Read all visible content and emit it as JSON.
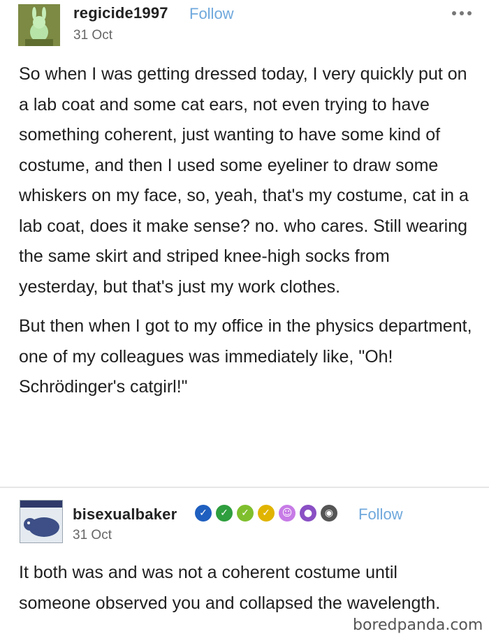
{
  "post1": {
    "username": "regicide1997",
    "follow_label": "Follow",
    "date": "31 Oct",
    "paragraph1": "So when I was getting dressed today, I very quickly put on a lab coat and some cat ears, not even trying to have something coherent, just wanting to have some kind of costume, and then I used some eyeliner to draw some whiskers on my face, so, yeah, that's my costume, cat in a lab coat, does it make sense? no. who cares. Still wearing the same skirt and striped knee-high socks from yesterday, but that's just my work clothes.",
    "paragraph2": "But then when I got to my office in the physics department, one of my colleagues was immediately like, \"Oh! Schrödinger's catgirl!\""
  },
  "post2": {
    "username": "bisexualbaker",
    "follow_label": "Follow",
    "date": "31 Oct",
    "text": "It both was and was not a coherent costume until someone observed you and collapsed the wavelength.",
    "badge_colors": [
      "#1f5fbf",
      "#2e9e3e",
      "#7fbf2e",
      "#e0b400",
      "#c77be6",
      "#8a4fc4",
      "#555555"
    ]
  },
  "watermark": "boredpanda.com",
  "colors": {
    "follow": "#6fa8dc",
    "text": "#1f1f1f"
  }
}
